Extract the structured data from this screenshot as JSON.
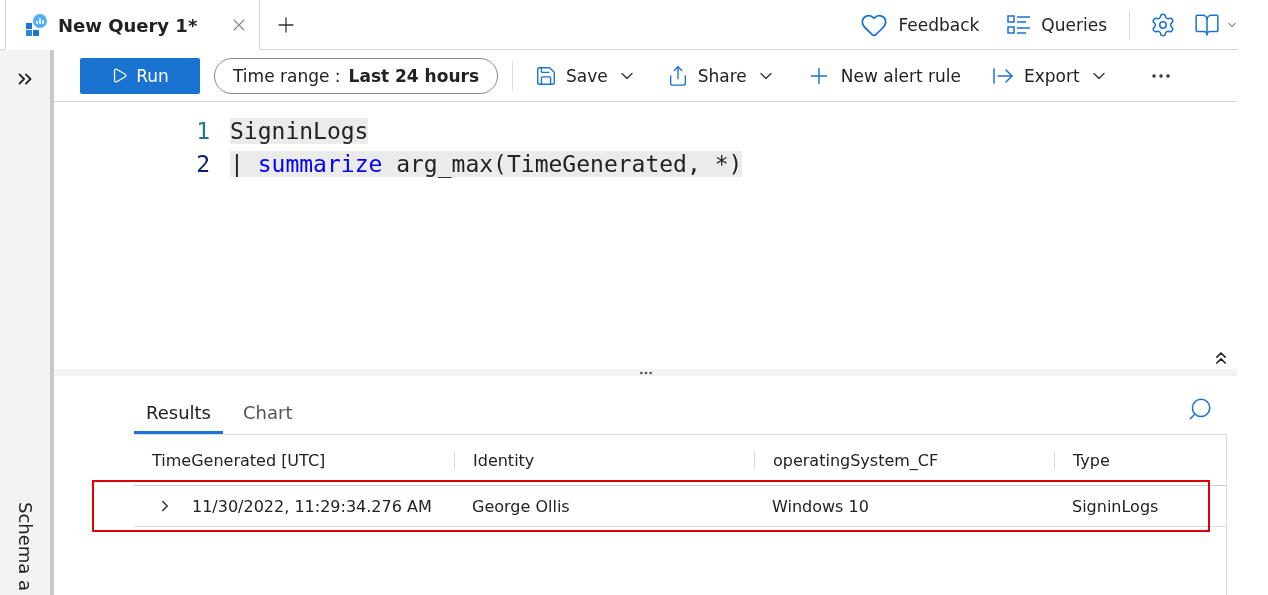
{
  "tab": {
    "title": "New Query 1*"
  },
  "header_actions": [
    {
      "kind": "feedback",
      "label": "Feedback"
    },
    {
      "kind": "queries",
      "label": "Queries"
    }
  ],
  "sidebar": {
    "label": "Schema a"
  },
  "toolbar": {
    "run": "Run",
    "time_range": {
      "label": "Time range :",
      "value": "Last 24 hours"
    },
    "items": [
      {
        "kind": "save",
        "label": "Save",
        "dropdown": true
      },
      {
        "kind": "share",
        "label": "Share",
        "dropdown": true
      },
      {
        "kind": "alert",
        "label": "New alert rule",
        "dropdown": false
      },
      {
        "kind": "export",
        "label": "Export",
        "dropdown": true
      }
    ]
  },
  "editor": {
    "lines": [
      {
        "number": "1",
        "active": false,
        "tokens": [
          {
            "kind": "plain",
            "text": "SigninLogs"
          }
        ]
      },
      {
        "number": "2",
        "active": true,
        "tokens": [
          {
            "kind": "plain",
            "text": "| "
          },
          {
            "kind": "keyword",
            "text": "summarize"
          },
          {
            "kind": "plain",
            "text": " arg_max(TimeGenerated, *)"
          }
        ]
      }
    ]
  },
  "results": {
    "tabs": [
      {
        "label": "Results",
        "selected": true
      },
      {
        "label": "Chart",
        "selected": false
      }
    ],
    "columns": [
      "TimeGenerated [UTC]",
      "Identity",
      "operatingSystem_CF",
      "Type"
    ],
    "rows": [
      {
        "highlighted": true,
        "expanded": false,
        "cells": [
          "11/30/2022, 11:29:34.276 AM",
          "George Ollis",
          "Windows 10",
          "SigninLogs"
        ]
      }
    ]
  }
}
